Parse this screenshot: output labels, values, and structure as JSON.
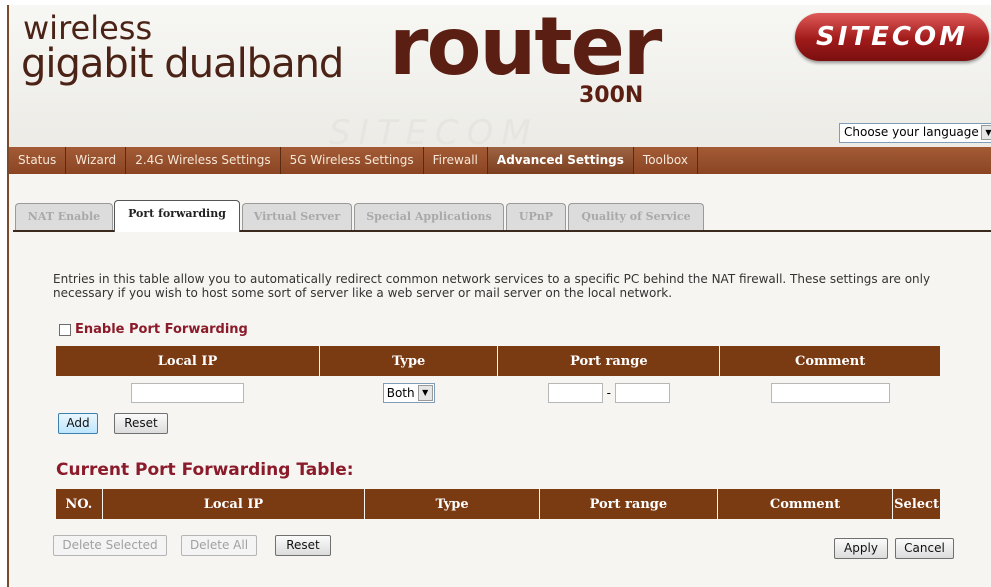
{
  "header": {
    "line1": "wireless",
    "line2": "gigabit dualband",
    "router": "router",
    "model": "300N",
    "logo_text": "SITECOM",
    "watermark": "SITECOM",
    "language_select": "Choose your language"
  },
  "nav": {
    "items": [
      {
        "label": "Status"
      },
      {
        "label": "Wizard"
      },
      {
        "label": "2.4G Wireless Settings"
      },
      {
        "label": "5G Wireless Settings"
      },
      {
        "label": "Firewall"
      },
      {
        "label": "Advanced Settings"
      },
      {
        "label": "Toolbox"
      }
    ],
    "active": "Advanced Settings"
  },
  "tabs": {
    "items": [
      {
        "label": "NAT Enable"
      },
      {
        "label": "Port forwarding"
      },
      {
        "label": "Virtual Server"
      },
      {
        "label": "Special Applications"
      },
      {
        "label": "UPnP"
      },
      {
        "label": "Quality of Service"
      }
    ],
    "active": "Port forwarding"
  },
  "description": "Entries in this table allow you to automatically redirect common network services to a specific PC behind the NAT firewall. These settings are only necessary if you wish to host some sort of server like a web server or mail server on the local network.",
  "enable_label": "Enable Port Forwarding",
  "form_table": {
    "headers": [
      "Local IP",
      "Type",
      "Port range",
      "Comment"
    ],
    "type_value": "Both",
    "port_separator": "-"
  },
  "buttons": {
    "add": "Add",
    "reset": "Reset",
    "delete_selected": "Delete Selected",
    "delete_all": "Delete All",
    "reset2": "Reset",
    "apply": "Apply",
    "cancel": "Cancel"
  },
  "current_table": {
    "title": "Current Port Forwarding Table:",
    "headers": [
      "NO.",
      "Local IP",
      "Type",
      "Port range",
      "Comment",
      "Select"
    ]
  },
  "colors": {
    "brand_brown": "#5a1f12",
    "nav_brown": "#8b4523",
    "table_header": "#7a3a12",
    "accent_red": "#8b1a2a"
  }
}
